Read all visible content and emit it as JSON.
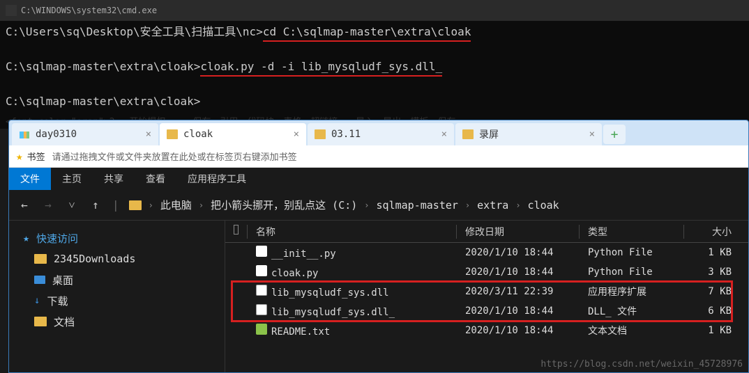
{
  "cmd": {
    "title": "C:\\WINDOWS\\system32\\cmd.exe",
    "line1_prompt": "C:\\Users\\sq\\Desktop\\安全工具\\扫描工具\\nc>",
    "line1_cmd": "cd C:\\sqlmap-master\\extra\\cloak",
    "line2_prompt": "C:\\sqlmap-master\\extra\\cloak>",
    "line2_cmd": "cloak.py -d -i lib_mysqludf_sys.dll_",
    "line3_prompt": "C:\\sqlmap-master\\extra\\cloak>"
  },
  "tabs": [
    {
      "label": "day0310",
      "active": false
    },
    {
      "label": "cloak",
      "active": true
    },
    {
      "label": "03.11",
      "active": false
    },
    {
      "label": "录屏",
      "active": false
    }
  ],
  "bookmark": {
    "label": "书签",
    "hint": "请通过拖拽文件或文件夹放置在此处或在标签页右键添加书签"
  },
  "ribbon": {
    "tabs": [
      "文件",
      "主页",
      "共享",
      "查看",
      "应用程序工具"
    ],
    "active": 0
  },
  "breadcrumb": [
    "此电脑",
    "把小箭头挪开，别乱点这 (C:)",
    "sqlmap-master",
    "extra",
    "cloak"
  ],
  "sidebar": {
    "quick_access": "快速访问",
    "items": [
      "2345Downloads",
      "桌面",
      "下载",
      "文档"
    ]
  },
  "columns": {
    "name": "名称",
    "date": "修改日期",
    "type": "类型",
    "size": "大小"
  },
  "files": [
    {
      "name": "__init__.py",
      "date": "2020/1/10 18:44",
      "type": "Python File",
      "size": "1 KB",
      "icon": "py"
    },
    {
      "name": "cloak.py",
      "date": "2020/1/10 18:44",
      "type": "Python File",
      "size": "3 KB",
      "icon": "py"
    },
    {
      "name": "lib_mysqludf_sys.dll",
      "date": "2020/3/11 22:39",
      "type": "应用程序扩展",
      "size": "7 KB",
      "icon": "dll"
    },
    {
      "name": "lib_mysqludf_sys.dll_",
      "date": "2020/1/10 18:44",
      "type": "DLL_ 文件",
      "size": "6 KB",
      "icon": "dll"
    },
    {
      "name": "README.txt",
      "date": "2020/1/10 18:44",
      "type": "文本文档",
      "size": "1 KB",
      "icon": "txt"
    }
  ],
  "watermark": "https://blog.csdn.net/weixin_45728976"
}
